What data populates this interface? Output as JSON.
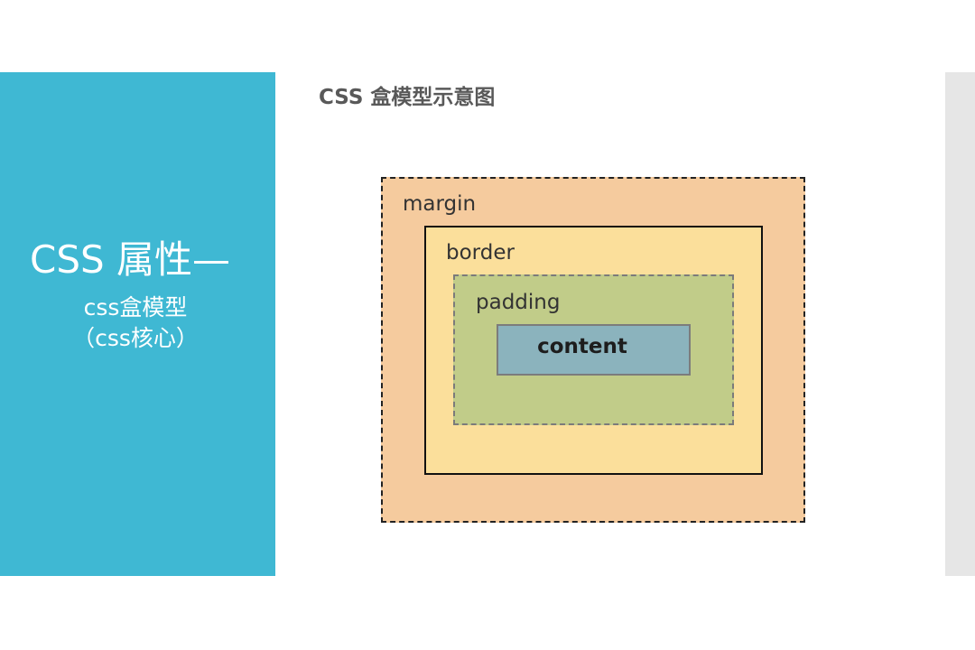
{
  "slide": {
    "sidebar": {
      "title": "CSS 属性—",
      "subtitle_line1": "css盒模型",
      "subtitle_line2": "（css核心）"
    },
    "diagram": {
      "title": "CSS 盒模型示意图",
      "layers": {
        "margin": "margin",
        "border": "border",
        "padding": "padding",
        "content": "content"
      }
    },
    "colors": {
      "sidebar": "#3fb8d3",
      "margin": "#f5cb9e",
      "border": "#fbdf9b",
      "padding": "#c1cc89",
      "content": "#8bb3bd",
      "right_strip": "#e6e6e6"
    }
  }
}
